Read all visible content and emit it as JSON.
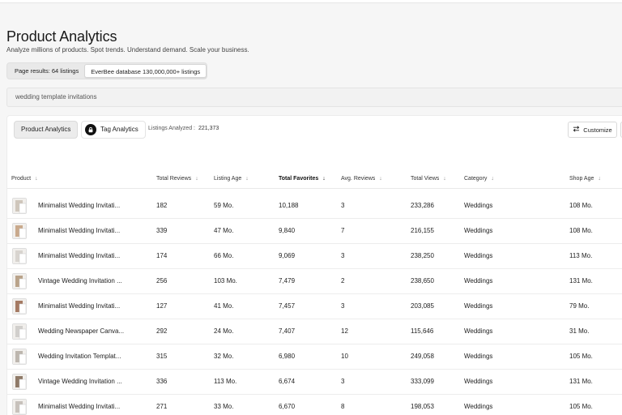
{
  "header": {
    "title": "Product Analytics",
    "subtitle": "Analyze millions of products. Spot trends. Understand demand. Scale your business."
  },
  "mode_toggle": {
    "page_results": "Page results: 64 listings",
    "database": "EverBee database 130,000,000+ listings"
  },
  "search": {
    "value": "wedding template invitations"
  },
  "tabs": {
    "product": "Product Analytics",
    "tag": "Tag Analytics"
  },
  "analyzed": {
    "label": "Listings Analyzed :",
    "value": "221,373"
  },
  "customize": {
    "label": "Customize"
  },
  "columns": [
    "Product",
    "Total Reviews",
    "Listing Age",
    "Total Favorites",
    "Avg. Reviews",
    "Total Views",
    "Category",
    "Shop Age"
  ],
  "rows": [
    {
      "product": "Minimalist Wedding Invitati...",
      "reviews": "182",
      "age": "59 Mo.",
      "favorites": "10,188",
      "avg": "3",
      "views": "233,286",
      "category": "Weddings",
      "shop_age": "108 Mo."
    },
    {
      "product": "Minimalist Wedding Invitati...",
      "reviews": "339",
      "age": "47 Mo.",
      "favorites": "9,840",
      "avg": "7",
      "views": "216,155",
      "category": "Weddings",
      "shop_age": "108 Mo."
    },
    {
      "product": "Minimalist Wedding Invitati...",
      "reviews": "174",
      "age": "66 Mo.",
      "favorites": "9,069",
      "avg": "3",
      "views": "238,250",
      "category": "Weddings",
      "shop_age": "113 Mo."
    },
    {
      "product": "Vintage Wedding Invitation ...",
      "reviews": "256",
      "age": "103 Mo.",
      "favorites": "7,479",
      "avg": "2",
      "views": "238,650",
      "category": "Weddings",
      "shop_age": "131 Mo."
    },
    {
      "product": "Minimalist Wedding Invitati...",
      "reviews": "127",
      "age": "41 Mo.",
      "favorites": "7,457",
      "avg": "3",
      "views": "203,085",
      "category": "Weddings",
      "shop_age": "79 Mo."
    },
    {
      "product": "Wedding Newspaper Canva...",
      "reviews": "292",
      "age": "24 Mo.",
      "favorites": "7,407",
      "avg": "12",
      "views": "115,646",
      "category": "Weddings",
      "shop_age": "31 Mo."
    },
    {
      "product": "Wedding Invitation Templat...",
      "reviews": "315",
      "age": "32 Mo.",
      "favorites": "6,980",
      "avg": "10",
      "views": "249,058",
      "category": "Weddings",
      "shop_age": "105 Mo."
    },
    {
      "product": "Vintage Wedding Invitation ...",
      "reviews": "336",
      "age": "113 Mo.",
      "favorites": "6,674",
      "avg": "3",
      "views": "333,099",
      "category": "Weddings",
      "shop_age": "131 Mo."
    },
    {
      "product": "Minimalist Wedding Invitati...",
      "reviews": "271",
      "age": "33 Mo.",
      "favorites": "6,670",
      "avg": "8",
      "views": "198,053",
      "category": "Weddings",
      "shop_age": "105 Mo."
    }
  ],
  "thumb_colors": [
    "#cfc6bb",
    "#c9a98c",
    "#d8d4cf",
    "#b9a38a",
    "#a57a63",
    "#d1cfcc",
    "#bdb6ae",
    "#8f7a68",
    "#c7c1bb"
  ]
}
